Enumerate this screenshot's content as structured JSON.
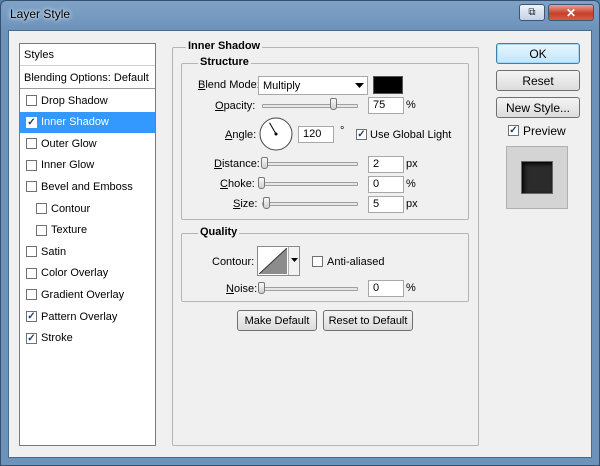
{
  "window": {
    "title": "Layer Style",
    "restore_glyph": "⧉",
    "close_glyph": "✕"
  },
  "left_panel": {
    "styles_label": "Styles",
    "blending_label": "Blending Options: Default",
    "items": [
      {
        "label": "Drop Shadow",
        "checked": false,
        "selected": false,
        "sub": false
      },
      {
        "label": "Inner Shadow",
        "checked": true,
        "selected": true,
        "sub": false
      },
      {
        "label": "Outer Glow",
        "checked": false,
        "selected": false,
        "sub": false
      },
      {
        "label": "Inner Glow",
        "checked": false,
        "selected": false,
        "sub": false
      },
      {
        "label": "Bevel and Emboss",
        "checked": false,
        "selected": false,
        "sub": false
      },
      {
        "label": "Contour",
        "checked": false,
        "selected": false,
        "sub": true
      },
      {
        "label": "Texture",
        "checked": false,
        "selected": false,
        "sub": true
      },
      {
        "label": "Satin",
        "checked": false,
        "selected": false,
        "sub": false
      },
      {
        "label": "Color Overlay",
        "checked": false,
        "selected": false,
        "sub": false
      },
      {
        "label": "Gradient Overlay",
        "checked": false,
        "selected": false,
        "sub": false
      },
      {
        "label": "Pattern Overlay",
        "checked": true,
        "selected": false,
        "sub": false
      },
      {
        "label": "Stroke",
        "checked": true,
        "selected": false,
        "sub": false
      }
    ]
  },
  "inner_shadow": {
    "section_title": "Inner Shadow",
    "structure": {
      "title": "Structure",
      "blend_mode_label": "Blend Mode:",
      "blend_mode_key": "B",
      "blend_mode_rest": "lend Mode:",
      "blend_mode_value": "Multiply",
      "shadow_color": "#000000",
      "opacity_key": "O",
      "opacity_rest": "pacity:",
      "opacity_value": "75",
      "opacity_unit": "%",
      "opacity_fraction": 0.75,
      "angle_key": "A",
      "angle_rest": "ngle:",
      "angle_value": "120",
      "angle_unit": "°",
      "angle_degrees": 120,
      "use_global_light_label": "Use Global Light",
      "use_global_light_key": "G",
      "use_global_light_checked": true,
      "distance_key": "D",
      "distance_rest": "istance:",
      "distance_value": "2",
      "distance_unit": "px",
      "choke_key": "C",
      "choke_rest": "hoke:",
      "choke_value": "0",
      "choke_unit": "%",
      "size_key": "S",
      "size_rest": "ize:",
      "size_value": "5",
      "size_unit": "px"
    },
    "quality": {
      "title": "Quality",
      "contour_label": "Contour:",
      "anti_aliased_label": "Anti-aliased",
      "anti_aliased_checked": false,
      "noise_key": "N",
      "noise_rest": "oise:",
      "noise_value": "0",
      "noise_unit": "%"
    },
    "make_default_label": "Make Default",
    "reset_default_label": "Reset to Default"
  },
  "right": {
    "ok_label": "OK",
    "reset_label": "Reset",
    "new_style_label": "New Style...",
    "preview_label": "Preview",
    "preview_checked": true
  },
  "icons": {
    "checkmark": "check-icon",
    "dropdown": "chevron-down-icon"
  }
}
